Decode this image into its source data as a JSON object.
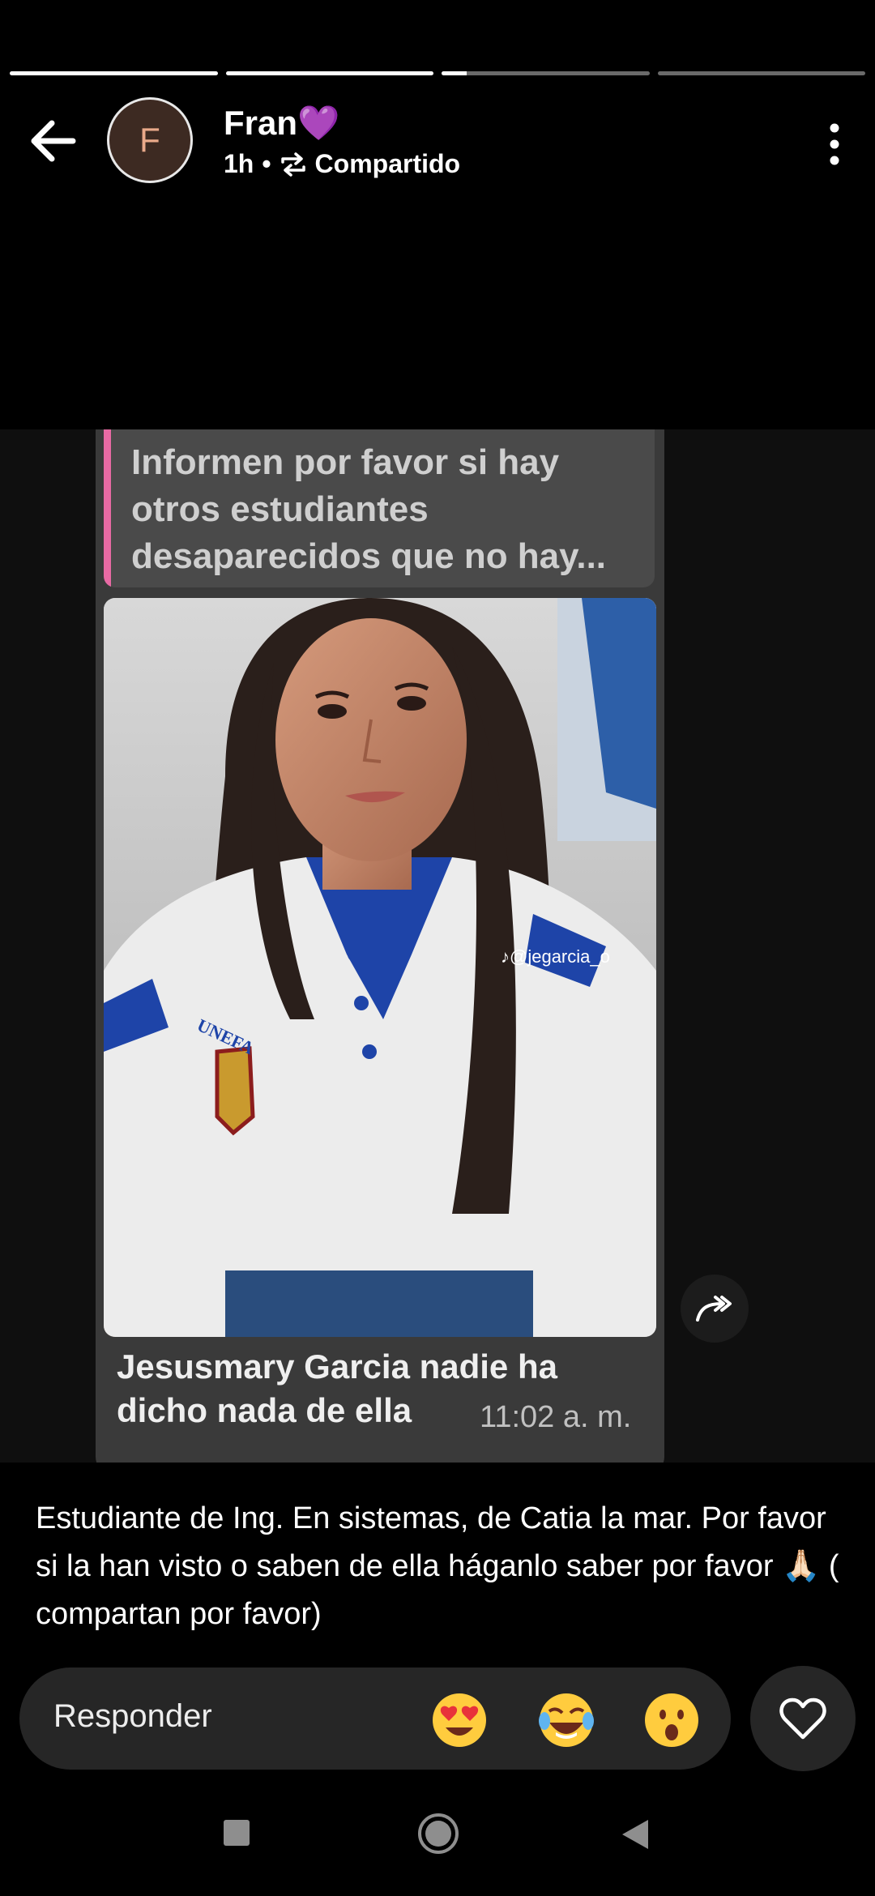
{
  "story_progress": [
    1.0,
    1.0,
    0.12,
    0.0
  ],
  "header": {
    "avatar_letter": "F",
    "name": "Fran💜",
    "time_ago": "1h",
    "separator": "•",
    "shared_label": "Compartido"
  },
  "message": {
    "quote_text": "Informen por favor si hay otros estudiantes desaparecidos que no hay...",
    "watermark": "@jegarcia_o",
    "emblem_text": "UNEFA",
    "caption": "Jesusmary Garcia nadie ha dicho nada de ella",
    "time": "11:02 a. m.",
    "quote_bar_color": "#e86aa4"
  },
  "description": "Estudiante de Ing. En sistemas, de Catia la mar. Por favor si la han visto o saben de ella háganlo saber por favor 🙏🏻 ( compartan por favor)",
  "reply": {
    "placeholder": "Responder",
    "reactions": [
      "heart-eyes-emoji",
      "laughing-tears-emoji",
      "surprised-emoji"
    ]
  },
  "icons": [
    "back-arrow-icon",
    "repost-icon",
    "more-vert-icon",
    "share-forward-icon",
    "heart-icon",
    "recents-icon",
    "home-icon",
    "back-triangle-icon"
  ]
}
